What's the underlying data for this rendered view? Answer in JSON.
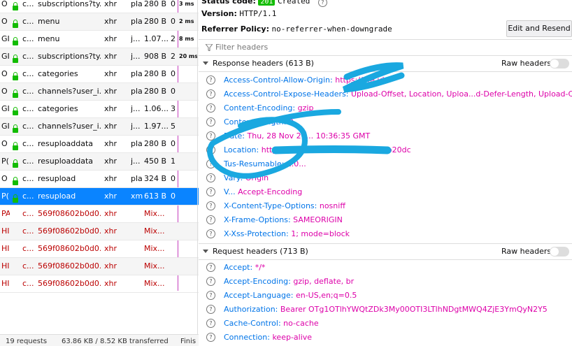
{
  "requests": [
    {
      "method": "O",
      "domain": "c...",
      "file": "subscriptions?ty...",
      "cause": "xhr",
      "type": "pla",
      "transferred": "280 B",
      "size": "0",
      "time": "3 ms",
      "style": "normal"
    },
    {
      "method": "O",
      "domain": "c...",
      "file": "menu",
      "cause": "xhr",
      "type": "pla",
      "transferred": "280 B",
      "size": "0",
      "time": "2 ms",
      "style": "alt"
    },
    {
      "method": "GI",
      "domain": "c...",
      "file": "menu",
      "cause": "xhr",
      "type": "j...",
      "transferred": "1.07...",
      "size": "2.",
      "time": "8 ms",
      "style": "normal"
    },
    {
      "method": "GI",
      "domain": "c...",
      "file": "subscriptions?ty...",
      "cause": "xhr",
      "type": "j...",
      "transferred": "908 B",
      "size": "2.",
      "time": "20 ms",
      "style": "alt"
    },
    {
      "method": "O",
      "domain": "c...",
      "file": "categories",
      "cause": "xhr",
      "type": "pla",
      "transferred": "280 B",
      "size": "0",
      "time": "",
      "style": "normal"
    },
    {
      "method": "O",
      "domain": "c...",
      "file": "channels?user_i...",
      "cause": "xhr",
      "type": "pla",
      "transferred": "280 B",
      "size": "0",
      "time": "",
      "style": "alt"
    },
    {
      "method": "GI",
      "domain": "c...",
      "file": "categories",
      "cause": "xhr",
      "type": "j...",
      "transferred": "1.06...",
      "size": "3.",
      "time": "",
      "style": "normal"
    },
    {
      "method": "GI",
      "domain": "c...",
      "file": "channels?user_i...",
      "cause": "xhr",
      "type": "j...",
      "transferred": "1.97...",
      "size": "5!",
      "time": "",
      "style": "alt"
    },
    {
      "method": "O",
      "domain": "c...",
      "file": "resuploaddata",
      "cause": "xhr",
      "type": "pla",
      "transferred": "280 B",
      "size": "0",
      "time": "",
      "style": "normal"
    },
    {
      "method": "P(",
      "domain": "c...",
      "file": "resuploaddata",
      "cause": "xhr",
      "type": "j...",
      "transferred": "450 B",
      "size": "1",
      "time": "",
      "style": "alt"
    },
    {
      "method": "O",
      "domain": "c...",
      "file": "resupload",
      "cause": "xhr",
      "type": "pla",
      "transferred": "324 B",
      "size": "0",
      "time": "",
      "style": "normal"
    },
    {
      "method": "P(",
      "domain": "c...",
      "file": "resupload",
      "cause": "xhr",
      "type": "xm",
      "transferred": "613 B",
      "size": "0",
      "time": "",
      "style": "sel"
    },
    {
      "method": "PA",
      "domain": "c...",
      "file": "569f08602b0d0...",
      "cause": "xhr",
      "type": "",
      "transferred": "Mix...",
      "size": "",
      "time": "",
      "style": "err"
    },
    {
      "method": "HI",
      "domain": "c...",
      "file": "569f08602b0d0...",
      "cause": "xhr",
      "type": "",
      "transferred": "Mix...",
      "size": "",
      "time": "",
      "style": "erralt"
    },
    {
      "method": "HI",
      "domain": "c...",
      "file": "569f08602b0d0...",
      "cause": "xhr",
      "type": "",
      "transferred": "Mix...",
      "size": "",
      "time": "",
      "style": "err"
    },
    {
      "method": "HI",
      "domain": "c...",
      "file": "569f08602b0d0...",
      "cause": "xhr",
      "type": "",
      "transferred": "Mix...",
      "size": "",
      "time": "",
      "style": "erralt"
    },
    {
      "method": "HI",
      "domain": "c...",
      "file": "569f08602b0d0...",
      "cause": "xhr",
      "type": "",
      "transferred": "Mix...",
      "size": "",
      "time": "",
      "style": "err"
    }
  ],
  "statusbar": {
    "requests": "19 requests",
    "transferred": "63.86 KB / 8.52 KB transferred",
    "finish": "Finis"
  },
  "summary": {
    "status_label": "Status code:",
    "status_code": "201",
    "status_text": "Created",
    "version_label": "Version:",
    "version_value": "HTTP/1.1",
    "referrer_label": "Referrer Policy:",
    "referrer_value": "no-referrer-when-downgrade",
    "edit_resend": "Edit and Resend"
  },
  "filter_placeholder": "Filter headers",
  "response_section": {
    "title": "Response headers (613 B)",
    "raw_label": "Raw headers",
    "headers": [
      {
        "name": "Access-Control-Allow-Origin:",
        "value": "https://...e.id"
      },
      {
        "name": "Access-Control-Expose-Headers:",
        "value": "Upload-Offset, Location, Uploa...d-Defer-Length, Upload-Concat"
      },
      {
        "name": "Content-Encoding:",
        "value": "gzip"
      },
      {
        "name": "Content-Length:",
        "value": "0"
      },
      {
        "name": "Date:",
        "value": "Thu, 28 Nov 20... 10:36:35 GMT"
      },
      {
        "name": "Location:",
        "value": "http://...21b-4484-acc1-9019b30b20dc"
      },
      {
        "name": "Tus-Resumable:",
        "value": "1.0..."
      },
      {
        "name": "Vary:",
        "value": "Origin"
      },
      {
        "name": "V...",
        "value": "Accept-Encoding"
      },
      {
        "name": "X-Content-Type-Options:",
        "value": "nosniff"
      },
      {
        "name": "X-Frame-Options:",
        "value": "SAMEORIGIN"
      },
      {
        "name": "X-Xss-Protection:",
        "value": "1; mode=block"
      }
    ]
  },
  "request_section": {
    "title": "Request headers (713 B)",
    "raw_label": "Raw headers",
    "headers": [
      {
        "name": "Accept:",
        "value": "*/*"
      },
      {
        "name": "Accept-Encoding:",
        "value": "gzip, deflate, br"
      },
      {
        "name": "Accept-Language:",
        "value": "en-US,en;q=0.5"
      },
      {
        "name": "Authorization:",
        "value": "Bearer OTg1OTlhYWQtZDk3My00OTI3LTlhNDgtMWQ4ZjE3YmQyN2Y5"
      },
      {
        "name": "Cache-Control:",
        "value": "no-cache"
      },
      {
        "name": "Connection:",
        "value": "keep-alive"
      }
    ]
  },
  "icons": {
    "lock": "lock-icon",
    "help": "help-icon",
    "filter": "filter-icon",
    "twisty": "chevron-down-icon"
  },
  "colors": {
    "selected_row": "#0a84ff",
    "error_text": "#bb0000",
    "secure_lock": "#12bc00",
    "header_name": "#0074e8",
    "header_value": "#dd00a9",
    "scribble": "#1aa8e0"
  }
}
